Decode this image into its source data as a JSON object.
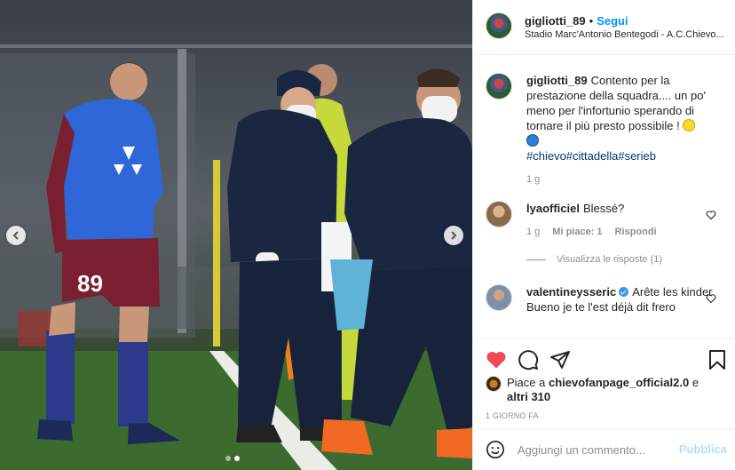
{
  "post": {
    "username": "gigliotti_89",
    "separator": "•",
    "follow_label": "Segui",
    "location": "Stadio Marc'Antonio Bentegodi - A.C.Chievo...",
    "player_number": "89"
  },
  "caption": {
    "username": "gigliotti_89",
    "text": "Contento per la prestazione della squadra.... un po' meno per l'infortunio sperando di tornare il più presto possibile ! ",
    "hashtags": "#chievo#cittadella#serieb",
    "time": "1 g"
  },
  "comments": [
    {
      "username": "lyaofficiel",
      "text": "Blessé?",
      "time": "1 g",
      "likes": "Mi piace: 1",
      "reply_label": "Rispondi",
      "view_replies": "Visualizza le risposte (1)"
    },
    {
      "username": "valentineysseric",
      "text": "Arête les kinder Bueno je te l'est déjà dit frero"
    }
  ],
  "likes": {
    "prefix": "Piace a ",
    "user": "chievofanpage_official2.0",
    "middle": " e ",
    "others": "altri 310"
  },
  "date": "1 GIORNO FA",
  "add_comment": {
    "placeholder": "Aggiungi un commento...",
    "post_label": "Pubblica"
  },
  "icons": {
    "like": "heart-filled-icon",
    "comment": "comment-icon",
    "share": "share-icon",
    "save": "bookmark-icon",
    "emoji": "smile-icon"
  },
  "colors": {
    "accent": "#0095f6",
    "like": "#ed4956",
    "hashtag": "#00376b",
    "muted": "#8e8e8e"
  }
}
